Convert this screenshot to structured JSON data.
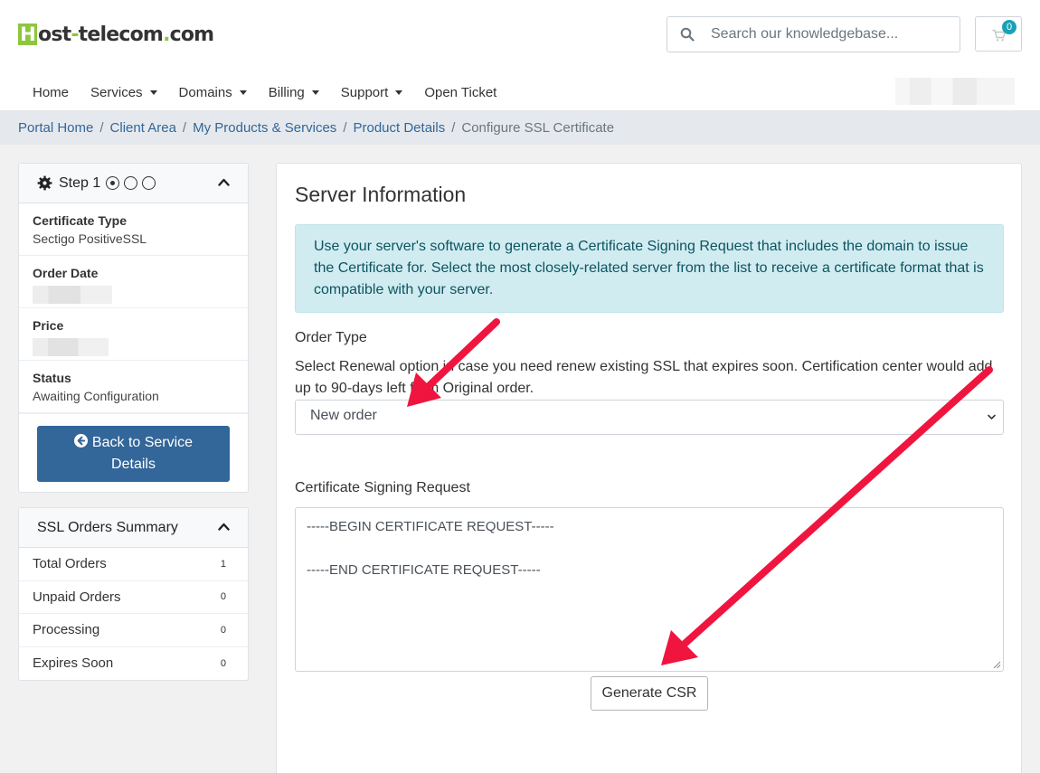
{
  "header": {
    "logo": {
      "letter": "H",
      "part1": "ost",
      "dash": "-",
      "part2": "telecom",
      "dot": ".",
      "part3": "com"
    },
    "search_placeholder": "Search our knowledgebase...",
    "cart_count": "0",
    "icons": {
      "search": "search-icon",
      "cart": "cart-icon"
    }
  },
  "nav": [
    {
      "label": "Home",
      "dropdown": false
    },
    {
      "label": "Services",
      "dropdown": true
    },
    {
      "label": "Domains",
      "dropdown": true
    },
    {
      "label": "Billing",
      "dropdown": true
    },
    {
      "label": "Support",
      "dropdown": true
    },
    {
      "label": "Open Ticket",
      "dropdown": false
    }
  ],
  "breadcrumb": {
    "items": [
      "Portal Home",
      "Client Area",
      "My Products & Services",
      "Product Details"
    ],
    "separator": "/",
    "active": "Configure SSL Certificate"
  },
  "step_card": {
    "title": "Step 1",
    "steps_total": 3,
    "current_step": 1,
    "rows": [
      {
        "label": "Certificate Type",
        "value": "Sectigo PositiveSSL"
      },
      {
        "label": "Order Date",
        "value": null
      },
      {
        "label": "Price",
        "value": null
      },
      {
        "label": "Status",
        "value": "Awaiting Configuration"
      }
    ],
    "back_button_line1": "Back to Service",
    "back_button_line2": "Details"
  },
  "summary_card": {
    "title": "SSL Orders Summary",
    "rows": [
      {
        "label": "Total Orders",
        "count": "1"
      },
      {
        "label": "Unpaid Orders",
        "count": "0"
      },
      {
        "label": "Processing",
        "count": "0"
      },
      {
        "label": "Expires Soon",
        "count": "0"
      }
    ]
  },
  "main": {
    "title": "Server Information",
    "info_alert": "Use your server's software to generate a Certificate Signing Request that includes the domain to issue the Certificate for. Select the most closely-related server from the list to receive a certificate format that is compatible with your server.",
    "order_type_label": "Order Type",
    "order_type_help_part1": "Select Renewal option in case you need renew existing SSL that expires soon. Certification center would",
    "order_type_help_part2": "add up to 90-days left from Original order.",
    "order_type_value": "New order",
    "csr_label": "Certificate Signing Request",
    "csr_begin": "-----BEGIN CERTIFICATE REQUEST-----",
    "csr_end": "-----END CERTIFICATE REQUEST-----",
    "generate_button": "Generate CSR"
  },
  "colors": {
    "brand_green": "#8dc63f",
    "link_blue": "#336699",
    "alert_bg": "#d1ecf1",
    "alert_text": "#0c5460",
    "badge": "#17a2b8",
    "annotation_arrow": "#f0153f"
  }
}
